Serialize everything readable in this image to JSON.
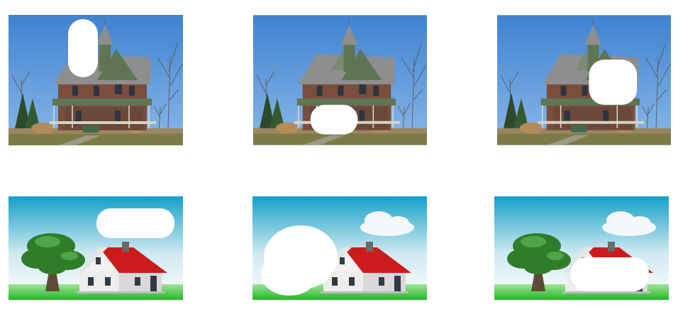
{
  "figure": {
    "rows": [
      {
        "subject": "victorian-house-photo",
        "panels": [
          {
            "variant": "original-with-mask",
            "mask_region": "upper-left-sky"
          },
          {
            "variant": "original-with-mask",
            "mask_region": "porch-center"
          },
          {
            "variant": "original-with-mask",
            "mask_region": "right-gable"
          }
        ]
      },
      {
        "subject": "cartoon-house-illustration",
        "panels": [
          {
            "variant": "original-with-mask",
            "mask_region": "cloud"
          },
          {
            "variant": "original-with-mask",
            "mask_region": "tree"
          },
          {
            "variant": "original-with-mask",
            "mask_region": "house-body"
          }
        ]
      }
    ],
    "colors": {
      "sky_blue": "#4f8fd6",
      "roof_gray": "#8e8e8e",
      "house_green": "#5f7553",
      "brick": "#7a4e3c",
      "grass": "#7d7a45",
      "cartoon_sky_top": "#1aa0c8",
      "cartoon_roof_red": "#cc1b1b",
      "cartoon_grass": "#2bc12b",
      "mask_white": "#ffffff"
    }
  }
}
